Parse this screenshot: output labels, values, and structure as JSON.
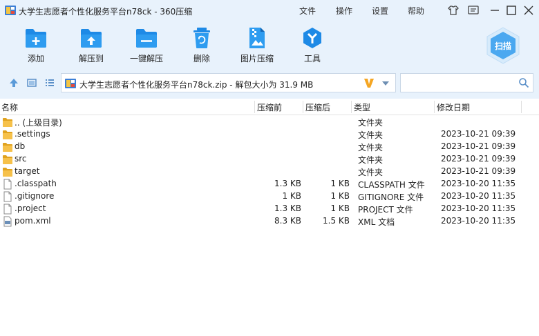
{
  "window": {
    "title": "大学生志愿者个性化服务平台n78ck - 360压缩",
    "menu": [
      "文件",
      "操作",
      "设置",
      "帮助"
    ]
  },
  "toolbar": {
    "buttons": [
      {
        "label": "添加",
        "icon": "add-icon"
      },
      {
        "label": "解压到",
        "icon": "extract-to-icon"
      },
      {
        "label": "一键解压",
        "icon": "one-click-extract-icon"
      },
      {
        "label": "删除",
        "icon": "delete-icon"
      },
      {
        "label": "图片压缩",
        "icon": "image-compress-icon"
      },
      {
        "label": "工具",
        "icon": "tools-icon"
      }
    ],
    "scan_label": "扫描"
  },
  "address": {
    "path": "大学生志愿者个性化服务平台n78ck.zip - 解包大小为 31.9 MB",
    "search_value": "",
    "search_placeholder": ""
  },
  "columns": {
    "name": "名称",
    "size": "压缩前",
    "packed": "压缩后",
    "type": "类型",
    "modified": "修改日期"
  },
  "files": [
    {
      "name": ".. (上级目录)",
      "size": "",
      "packed": "",
      "type": "文件夹",
      "modified": "",
      "kind": "folder"
    },
    {
      "name": ".settings",
      "size": "",
      "packed": "",
      "type": "文件夹",
      "modified": "2023-10-21 09:39",
      "kind": "folder"
    },
    {
      "name": "db",
      "size": "",
      "packed": "",
      "type": "文件夹",
      "modified": "2023-10-21 09:39",
      "kind": "folder"
    },
    {
      "name": "src",
      "size": "",
      "packed": "",
      "type": "文件夹",
      "modified": "2023-10-21 09:39",
      "kind": "folder"
    },
    {
      "name": "target",
      "size": "",
      "packed": "",
      "type": "文件夹",
      "modified": "2023-10-21 09:39",
      "kind": "folder"
    },
    {
      "name": ".classpath",
      "size": "1.3 KB",
      "packed": "1 KB",
      "type": "CLASSPATH 文件",
      "modified": "2023-10-20 11:35",
      "kind": "file"
    },
    {
      "name": ".gitignore",
      "size": "1 KB",
      "packed": "1 KB",
      "type": "GITIGNORE 文件",
      "modified": "2023-10-20 11:35",
      "kind": "file"
    },
    {
      "name": ".project",
      "size": "1.3 KB",
      "packed": "1 KB",
      "type": "PROJECT 文件",
      "modified": "2023-10-20 11:35",
      "kind": "file"
    },
    {
      "name": "pom.xml",
      "size": "8.3 KB",
      "packed": "1.5 KB",
      "type": "XML 文档",
      "modified": "2023-10-20 11:35",
      "kind": "xml"
    }
  ],
  "colors": {
    "accent": "#1e8ae6",
    "top_bg": "#e8f2fc",
    "folder": "#f2b531"
  }
}
